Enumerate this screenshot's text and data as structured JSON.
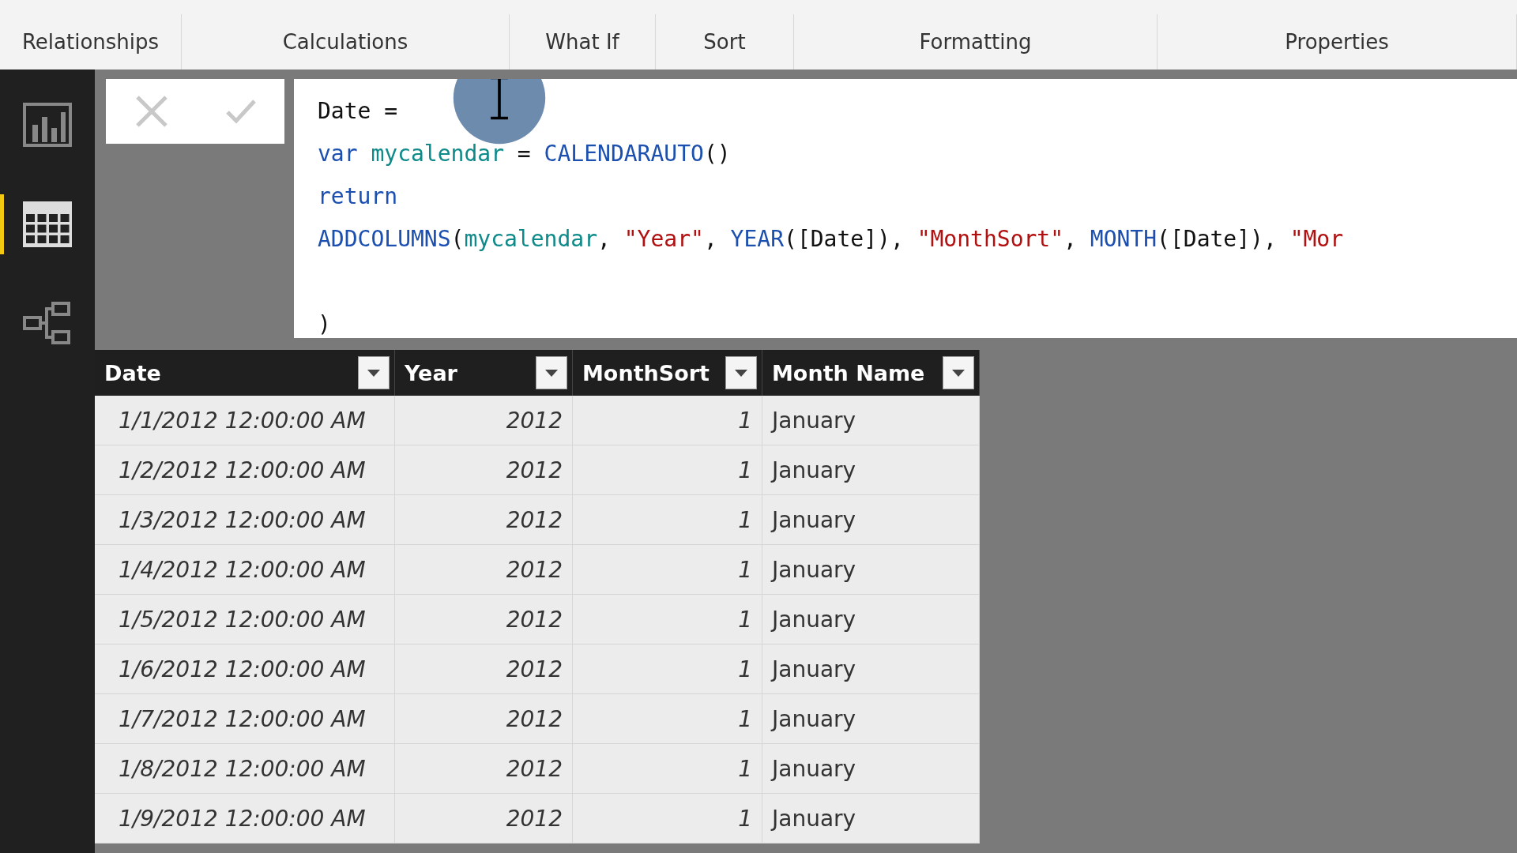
{
  "ribbon": {
    "groups": [
      "Relationships",
      "Calculations",
      "What If",
      "Sort",
      "Formatting",
      "Properties"
    ]
  },
  "sidebar": {
    "items": [
      {
        "kind": "report",
        "selected": false
      },
      {
        "kind": "data",
        "selected": true
      },
      {
        "kind": "model",
        "selected": false
      }
    ]
  },
  "formula_bar": {
    "lines": [
      {
        "tokens": [
          {
            "kind": "plain",
            "text": "Date ="
          }
        ]
      },
      {
        "tokens": [
          {
            "kind": "keyword",
            "text": "var "
          },
          {
            "kind": "variable",
            "text": "mycalendar"
          },
          {
            "kind": "plain",
            "text": " = "
          },
          {
            "kind": "function",
            "text": "CALENDARAUTO"
          },
          {
            "kind": "plain",
            "text": "()"
          }
        ]
      },
      {
        "tokens": [
          {
            "kind": "keyword",
            "text": "return"
          }
        ]
      },
      {
        "tokens": [
          {
            "kind": "function",
            "text": "ADDCOLUMNS"
          },
          {
            "kind": "plain",
            "text": "("
          },
          {
            "kind": "variable",
            "text": "mycalendar"
          },
          {
            "kind": "plain",
            "text": ", "
          },
          {
            "kind": "string",
            "text": "\"Year\""
          },
          {
            "kind": "plain",
            "text": ", "
          },
          {
            "kind": "function",
            "text": "YEAR"
          },
          {
            "kind": "plain",
            "text": "([Date]), "
          },
          {
            "kind": "string",
            "text": "\"MonthSort\""
          },
          {
            "kind": "plain",
            "text": ", "
          },
          {
            "kind": "function",
            "text": "MONTH"
          },
          {
            "kind": "plain",
            "text": "([Date]), "
          },
          {
            "kind": "string",
            "text": "\"Mor"
          }
        ]
      },
      {
        "tokens": [
          {
            "kind": "plain",
            "text": ")"
          }
        ],
        "blank_before": true
      }
    ]
  },
  "table": {
    "columns": [
      "Date",
      "Year",
      "MonthSort",
      "Month Name"
    ],
    "rows": [
      [
        "1/1/2012 12:00:00 AM",
        "2012",
        "1",
        "January"
      ],
      [
        "1/2/2012 12:00:00 AM",
        "2012",
        "1",
        "January"
      ],
      [
        "1/3/2012 12:00:00 AM",
        "2012",
        "1",
        "January"
      ],
      [
        "1/4/2012 12:00:00 AM",
        "2012",
        "1",
        "January"
      ],
      [
        "1/5/2012 12:00:00 AM",
        "2012",
        "1",
        "January"
      ],
      [
        "1/6/2012 12:00:00 AM",
        "2012",
        "1",
        "January"
      ],
      [
        "1/7/2012 12:00:00 AM",
        "2012",
        "1",
        "January"
      ],
      [
        "1/8/2012 12:00:00 AM",
        "2012",
        "1",
        "January"
      ],
      [
        "1/9/2012 12:00:00 AM",
        "2012",
        "1",
        "January"
      ]
    ]
  }
}
